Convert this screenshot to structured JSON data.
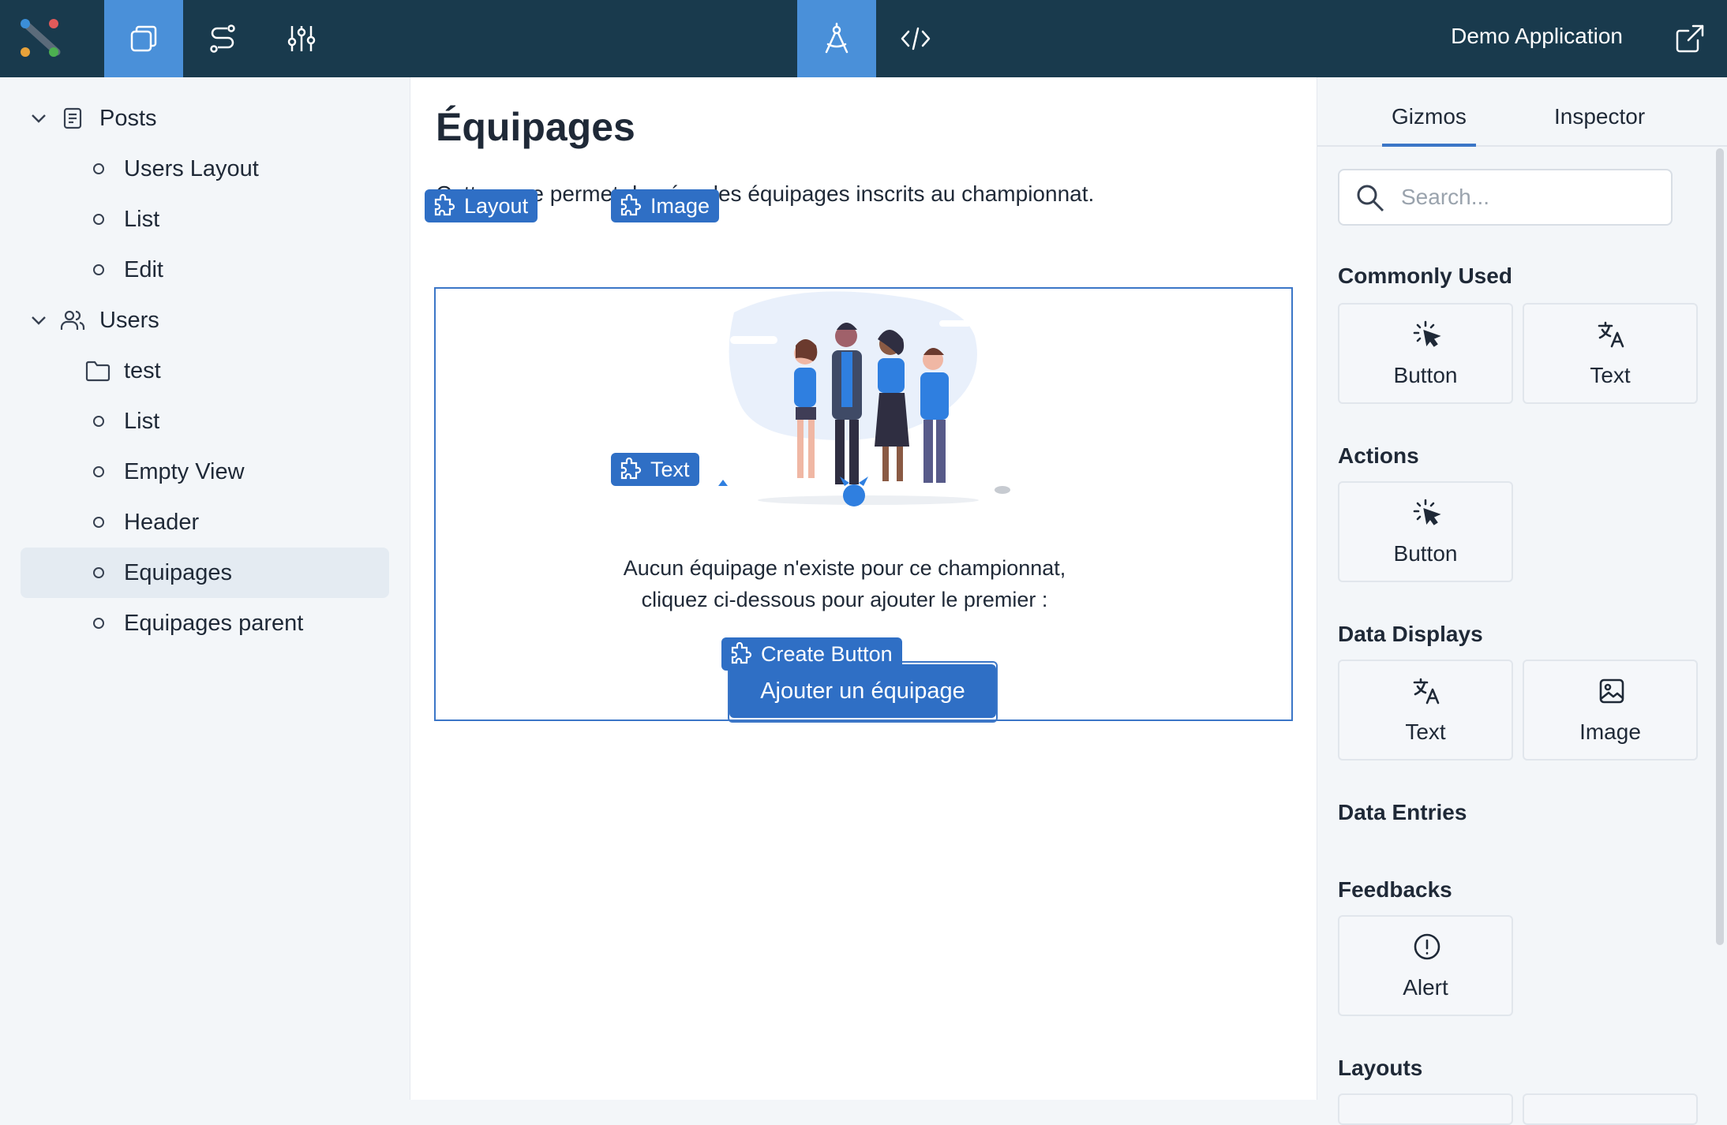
{
  "topbar": {
    "app_title": "Demo Application",
    "buttons": [
      {
        "icon": "pages-icon",
        "active": true
      },
      {
        "icon": "routes-icon",
        "active": false
      },
      {
        "icon": "settings-sliders-icon",
        "active": false
      },
      {
        "icon": "design-compass-icon",
        "active": true
      },
      {
        "icon": "code-icon",
        "active": false
      }
    ],
    "external_icon": "external-link-icon"
  },
  "sidebar": {
    "groups": [
      {
        "label": "Posts",
        "icon": "document-icon",
        "children": [
          {
            "label": "Users Layout"
          },
          {
            "label": "List"
          },
          {
            "label": "Edit"
          }
        ]
      },
      {
        "label": "Users",
        "icon": "users-icon",
        "children": [
          {
            "label": "test",
            "folder": true
          },
          {
            "label": "List"
          },
          {
            "label": "Empty View"
          },
          {
            "label": "Header"
          },
          {
            "label": "Equipages",
            "selected": true
          },
          {
            "label": "Equipages parent"
          }
        ]
      }
    ]
  },
  "main": {
    "title": "Équipages",
    "description": "Cette page permet de gérer les équipages inscrits au championnat.",
    "tags": {
      "layout": "Layout",
      "image": "Image",
      "text": "Text",
      "create_button": "Create Button"
    },
    "empty_line1": "Aucun équipage n'existe pour ce championnat,",
    "empty_line2": "cliquez ci-dessous pour ajouter le premier :",
    "create_button_label": "Ajouter un équipage"
  },
  "rpanel": {
    "tabs": [
      {
        "label": "Gizmos",
        "active": true
      },
      {
        "label": "Inspector",
        "active": false
      }
    ],
    "search_placeholder": "Search...",
    "sections": {
      "commonly_used": "Commonly Used",
      "actions": "Actions",
      "data_displays": "Data Displays",
      "data_entries": "Data Entries",
      "feedbacks": "Feedbacks",
      "layouts": "Layouts"
    },
    "gizmos": {
      "button": "Button",
      "text": "Text",
      "image": "Image",
      "alert": "Alert"
    }
  },
  "colors": {
    "topbar_bg": "#193a4d",
    "accent": "#2f6fc5",
    "active_top": "#4a90d9"
  }
}
